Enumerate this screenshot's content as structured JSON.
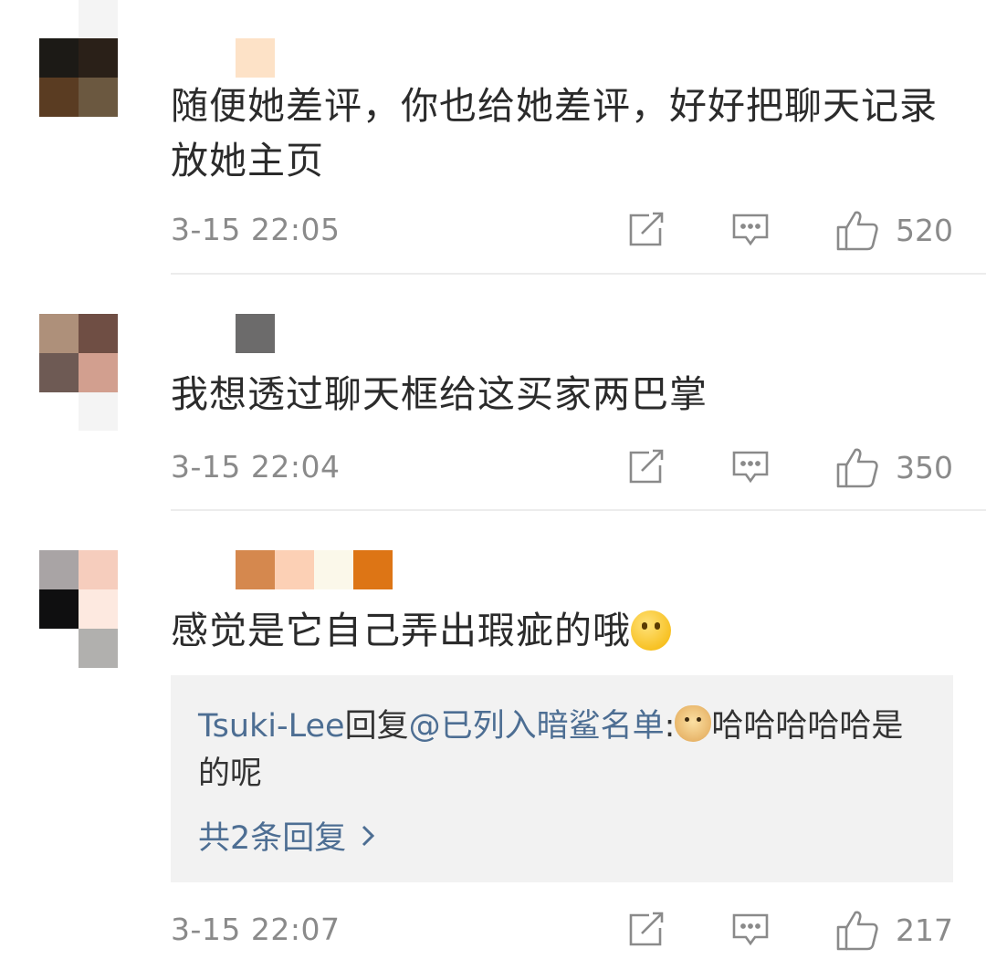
{
  "comments": [
    {
      "text": "随便她差评，你也给她差评，好好把聊天记录放她主页",
      "time": "3-15 22:05",
      "likes": "520",
      "avatar_colors": [
        "#1c1a16",
        "#2a2018",
        "#5a3c22",
        "#6b5840"
      ],
      "name_colors": [
        "#fde2c7"
      ]
    },
    {
      "text": "我想透过聊天框给这买家两巴掌",
      "time": "3-15 22:04",
      "likes": "350",
      "avatar_colors": [
        "#ae907a",
        "#6f4e44",
        "#6e5a54",
        "#d29f8f"
      ],
      "name_colors": [
        "#6c6b6b"
      ]
    },
    {
      "text": "感觉是它自己弄出瑕疵的哦",
      "emoji": "thinking-emoji",
      "time": "3-15 22:07",
      "likes": "217",
      "avatar_colors": [
        "#a9a4a5",
        "#f6cdbd",
        "#0f0f10",
        "#fde9e0",
        "#ffffff",
        "#b1b0ae"
      ],
      "name_colors": [
        "#d5884e",
        "#fcd0b5",
        "#fbf8ea",
        "#dd7515"
      ],
      "reply": {
        "user": "Tsuki-Lee",
        "reply_word": "回复",
        "mention": "@已列入暗鲨名单",
        "colon": ":",
        "emoji": "doge-emoji",
        "text": "哈哈哈哈哈是的呢",
        "total": "共2条回复"
      }
    }
  ],
  "icons": {
    "forward": "forward-icon",
    "reply": "comment-icon",
    "like": "thumbs-up-icon",
    "chevron": "chevron-right-icon"
  },
  "colors": {
    "link": "#4d6e93",
    "text": "#2b2b2b",
    "meta": "#8a8a8a",
    "reply_bg": "#f2f2f2",
    "divider": "#ececec"
  }
}
